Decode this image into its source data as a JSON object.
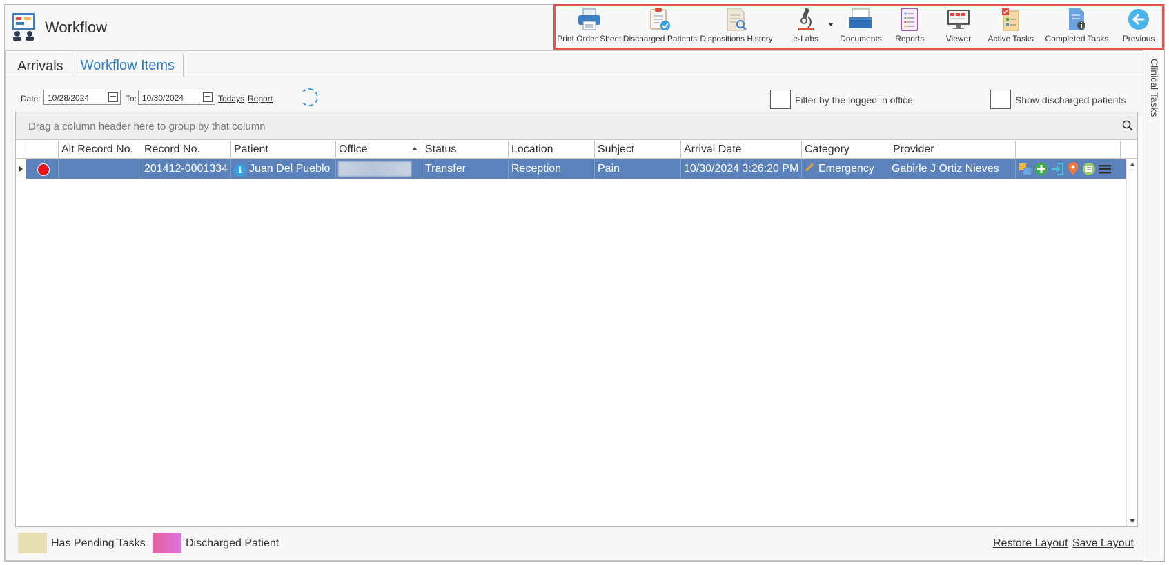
{
  "app": {
    "title": "Workflow"
  },
  "toolbar": {
    "items": [
      {
        "label": "Print Order Sheet",
        "icon": "printer-icon"
      },
      {
        "label": "Discharged Patients",
        "icon": "clipboard-check-icon"
      },
      {
        "label": "Dispositions History",
        "icon": "document-search-icon"
      },
      {
        "label": "e-Labs",
        "icon": "microscope-icon"
      },
      {
        "label": "Documents",
        "icon": "inbox-tray-icon"
      },
      {
        "label": "Reports",
        "icon": "report-list-icon"
      },
      {
        "label": "Viewer",
        "icon": "monitor-icon"
      },
      {
        "label": "Active Tasks",
        "icon": "task-list-icon"
      },
      {
        "label": "Completed Tasks",
        "icon": "task-info-icon"
      },
      {
        "label": "Previous",
        "icon": "back-arrow-icon"
      }
    ],
    "accent": "#e2544b"
  },
  "tabs": [
    {
      "label": "Arrivals",
      "active": false
    },
    {
      "label": "Workflow Items",
      "active": true
    }
  ],
  "filters": {
    "date_label": "Date:",
    "date_from": "10/28/2024",
    "to_label": "To:",
    "date_to": "10/30/2024",
    "todays_link": "Todays",
    "report_link": "Report",
    "filter_office_label": "Filter by the logged in office",
    "show_discharged_label": "Show discharged patients"
  },
  "grid": {
    "group_hint": "Drag a column header here to group by that column",
    "columns": [
      "Alt Record No.",
      "Record No.",
      "Patient",
      "Office",
      "Status",
      "Location",
      "Subject",
      "Arrival Date",
      "Category",
      "Provider"
    ],
    "rows": [
      {
        "alt_record_no": "",
        "record_no": "201412-0001334",
        "patient": "Juan Del Pueblo",
        "office": "",
        "status": "Transfer",
        "location": "Reception",
        "subject": "Pain",
        "arrival_date": "10/30/2024 3:26:20 PM",
        "category": "Emergency",
        "provider": "Gabirle J Ortiz Nieves"
      }
    ],
    "selected_row_color": "#5b82ba"
  },
  "legend": [
    {
      "label": "Has Pending Tasks",
      "color": "#e7e0b5"
    },
    {
      "label": "Discharged Patient",
      "color": "#e8609a"
    }
  ],
  "footer": {
    "restore_layout": "Restore Layout",
    "save_layout": "Save Layout"
  },
  "side_panel": {
    "label": "Clinical Tasks"
  }
}
